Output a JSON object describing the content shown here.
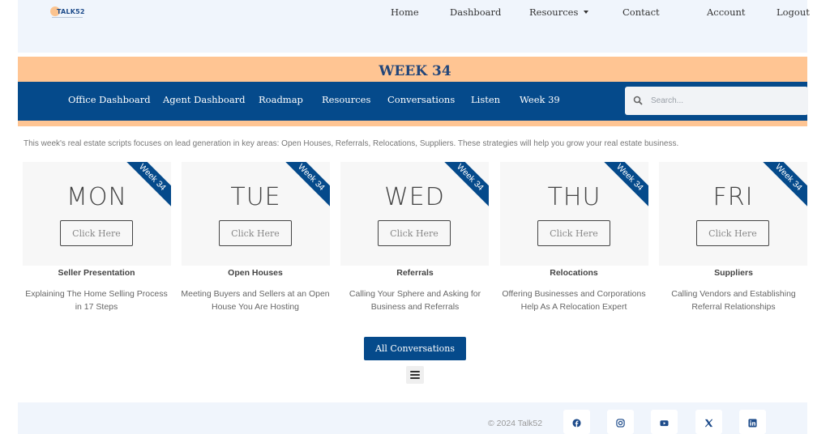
{
  "header": {
    "logo_text": "TALK52",
    "nav": [
      {
        "label": "Home"
      },
      {
        "label": "Dashboard"
      },
      {
        "label": "Resources",
        "has_dropdown": true
      },
      {
        "label": "Contact"
      },
      {
        "label": "Account"
      },
      {
        "label": "Logout"
      }
    ]
  },
  "banner": {
    "title": "WEEK 34",
    "nav": [
      {
        "label": "Office Dashboard"
      },
      {
        "label": "Agent Dashboard"
      },
      {
        "label": "Roadmap"
      },
      {
        "label": "Resources"
      },
      {
        "label": "Conversations"
      },
      {
        "label": "Listen"
      },
      {
        "label": "Week 39"
      }
    ],
    "search": {
      "placeholder": "Search...",
      "value": ""
    }
  },
  "intro": "This week's real estate scripts focuses on lead generation in key areas: Open Houses, Referrals, Relocations, Suppliers. These strategies will help you grow your real estate business.",
  "cards": [
    {
      "day": "MON",
      "ribbon": "Week 34",
      "button": "Click Here",
      "title": "Seller Presentation",
      "desc_line1": "Explaining The Home Selling Process",
      "desc_line2": "in 17 Steps"
    },
    {
      "day": "TUE",
      "ribbon": "Week 34",
      "button": "Click Here",
      "title": "Open Houses",
      "desc_line1": "Meeting Buyers and Sellers at an Open",
      "desc_line2": "House You Are Hosting"
    },
    {
      "day": "WED",
      "ribbon": "Week 34",
      "button": "Click Here",
      "title": "Referrals",
      "desc_line1": "Calling Your Sphere and Asking for",
      "desc_line2": "Business and Referrals"
    },
    {
      "day": "THU",
      "ribbon": "Week 34",
      "button": "Click Here",
      "title": "Relocations",
      "desc_line1": "Offering Businesses and Corporations",
      "desc_line2": "Help As A Relocation Expert"
    },
    {
      "day": "FRI",
      "ribbon": "Week 34",
      "button": "Click Here",
      "title": "Suppliers",
      "desc_line1": "Calling Vendors and Establishing",
      "desc_line2": "Referral Relationships"
    }
  ],
  "all_conversations_label": "All Conversations",
  "footer": {
    "copyright": "© 2024  Talk52",
    "social": [
      "facebook-icon",
      "instagram-icon",
      "youtube-icon",
      "x-icon",
      "linkedin-icon"
    ]
  },
  "colors": {
    "brand_blue": "#054a8b",
    "banner_peach": "#ffc593",
    "header_bg": "#f0f5fc"
  }
}
